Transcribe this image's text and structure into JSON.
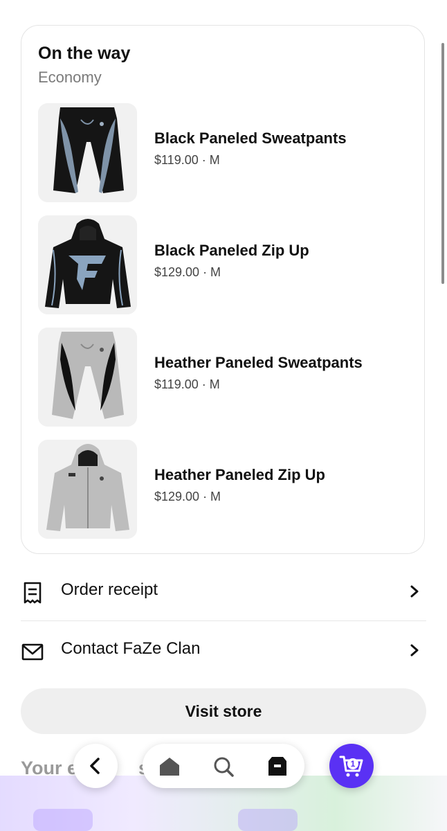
{
  "order": {
    "status_title": "On the way",
    "shipping_method": "Economy",
    "items": [
      {
        "name": "Black Paneled Sweatpants",
        "price": "$119.00",
        "size": "M",
        "meta": "$119.00 · M"
      },
      {
        "name": "Black Paneled Zip Up",
        "price": "$129.00",
        "size": "M",
        "meta": "$129.00 · M"
      },
      {
        "name": "Heather Paneled Sweatpants",
        "price": "$119.00",
        "size": "M",
        "meta": "$119.00 · M"
      },
      {
        "name": "Heather Paneled Zip Up",
        "price": "$129.00",
        "size": "M",
        "meta": "$129.00 · M"
      }
    ]
  },
  "actions": {
    "receipt_label": "Order receipt",
    "contact_label": "Contact FaZe Clan",
    "visit_store_label": "Visit store"
  },
  "section": {
    "heading_partial": "Your e",
    "heading_partial_2": "siv"
  },
  "nav": {
    "cart_count": "1",
    "icons": [
      "back-icon",
      "home-icon",
      "search-icon",
      "orders-box-icon",
      "cart-icon"
    ]
  },
  "colors": {
    "accent": "#5a31f4",
    "card_border": "#e4e4e4",
    "muted_text": "#7a7a7a"
  }
}
